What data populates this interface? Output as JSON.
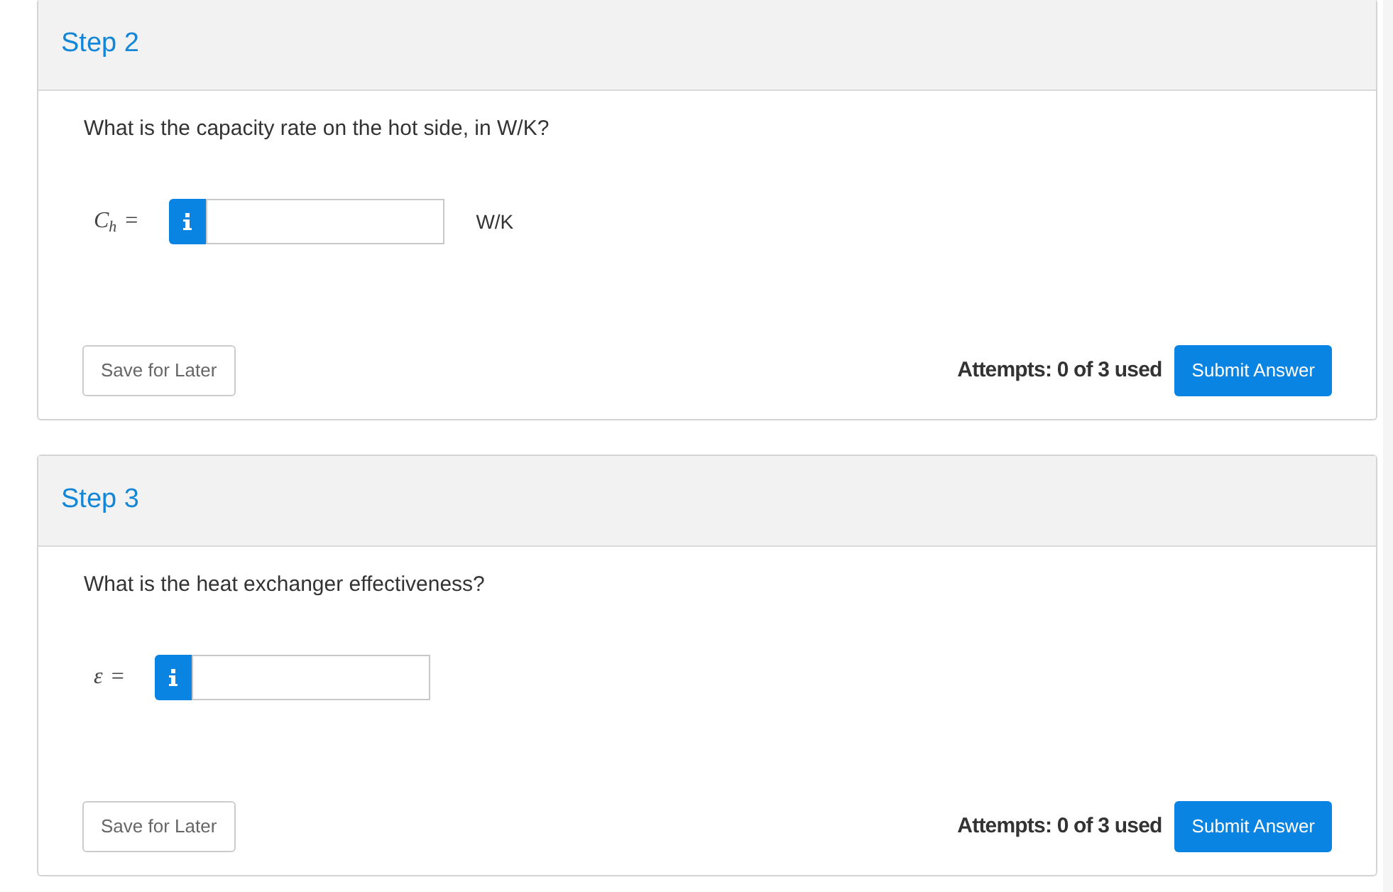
{
  "steps": [
    {
      "title": "Step 2",
      "question": "What is the capacity rate on the hot side, in W/K?",
      "equation": {
        "symbol": "C",
        "subscript": "h",
        "relation": "="
      },
      "unit": "W/K",
      "save_button": "Save for Later",
      "attempts": "Attempts: 0 of 3 used",
      "submit_button": "Submit Answer"
    },
    {
      "title": "Step 3",
      "question": "What is the heat exchanger effectiveness?",
      "equation": {
        "symbol": "ε",
        "relation": "="
      },
      "save_button": "Save for Later",
      "attempts": "Attempts: 0 of 3 used",
      "submit_button": "Submit Answer"
    }
  ]
}
